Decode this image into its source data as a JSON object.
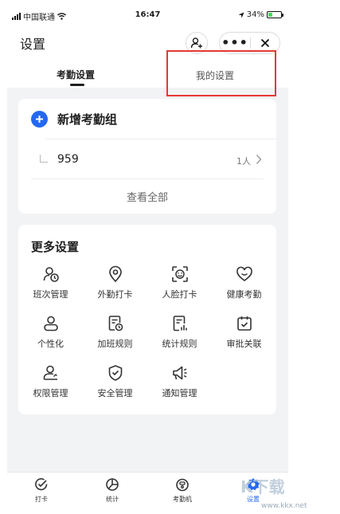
{
  "status_bar": {
    "carrier": "中国联通",
    "time": "16:47",
    "battery_percent": "34%"
  },
  "header": {
    "title": "设置",
    "more_glyph": "•••"
  },
  "tabs": [
    {
      "label": "考勤设置",
      "active": true
    },
    {
      "label": "我的设置",
      "active": false
    }
  ],
  "attendance_card": {
    "add_label": "新增考勤组",
    "groups": [
      {
        "name": "959",
        "count": "1人"
      }
    ],
    "view_all": "查看全部"
  },
  "more_settings": {
    "title": "更多设置",
    "items": [
      {
        "label": "班次管理",
        "icon": "shift-icon"
      },
      {
        "label": "外勤打卡",
        "icon": "location-pin-icon"
      },
      {
        "label": "人脸打卡",
        "icon": "face-scan-icon"
      },
      {
        "label": "健康考勤",
        "icon": "heart-icon"
      },
      {
        "label": "个性化",
        "icon": "user-icon"
      },
      {
        "label": "加班规则",
        "icon": "overtime-doc-icon"
      },
      {
        "label": "统计规则",
        "icon": "stats-doc-icon"
      },
      {
        "label": "审批关联",
        "icon": "calendar-check-icon"
      },
      {
        "label": "权限管理",
        "icon": "user-key-icon"
      },
      {
        "label": "安全管理",
        "icon": "shield-check-icon"
      },
      {
        "label": "通知管理",
        "icon": "megaphone-icon"
      }
    ]
  },
  "tabbar": [
    {
      "label": "打卡",
      "icon": "check-circle-icon",
      "active": false
    },
    {
      "label": "统计",
      "icon": "pie-chart-icon",
      "active": false
    },
    {
      "label": "考勤机",
      "icon": "device-icon",
      "active": false
    },
    {
      "label": "设置",
      "icon": "gear-icon",
      "active": true
    }
  ],
  "watermark": {
    "text": "K下载",
    "url": "www.kkx.net"
  },
  "colors": {
    "accent": "#2468f2",
    "highlight": "#e53935",
    "background": "#f2f3f5"
  }
}
